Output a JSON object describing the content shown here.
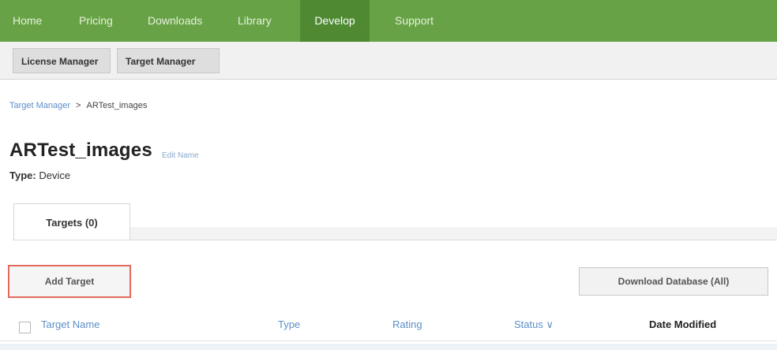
{
  "topnav": {
    "items": [
      {
        "label": "Home"
      },
      {
        "label": "Pricing"
      },
      {
        "label": "Downloads"
      },
      {
        "label": "Library"
      },
      {
        "label": "Develop"
      },
      {
        "label": "Support"
      }
    ],
    "active": "Develop",
    "color": "#67a346"
  },
  "subnav": {
    "tabs": [
      {
        "label": "License Manager"
      },
      {
        "label": "Target Manager"
      }
    ]
  },
  "breadcrumb": {
    "parent": "Target Manager",
    "separator": ">",
    "current": "ARTest_images"
  },
  "database": {
    "name": "ARTest_images",
    "edit_label": "Edit Name",
    "type_label": "Type:",
    "type_value": "Device"
  },
  "tabs": {
    "targets_label": "Targets (0)"
  },
  "actions": {
    "add_target": "Add Target",
    "download_database": "Download Database (All)"
  },
  "table": {
    "columns": [
      "Target Name",
      "Type",
      "Rating",
      "Status ∨",
      "Date Modified"
    ]
  },
  "highlight_color": "#e26a5e"
}
